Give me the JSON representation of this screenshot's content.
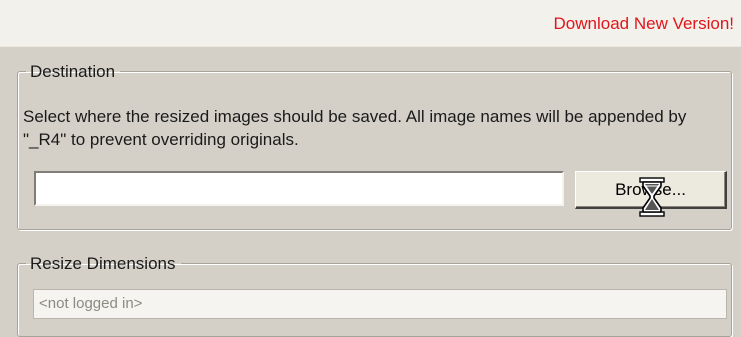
{
  "header": {
    "download_link": "Download New Version!"
  },
  "destination": {
    "legend": "Destination",
    "description": "Select where the resized images should be saved.  All image names will be appended by \"_R4\" to prevent overriding originals.",
    "path_value": "",
    "browse_label": "Browse..."
  },
  "resize": {
    "legend": "Resize Dimensions",
    "status_text": "<not logged in>"
  },
  "cursor": {
    "icon": "hourglass-icon"
  },
  "colors": {
    "window_bg": "#d4d0c8",
    "top_strip": "#f2f1ec",
    "link": "#e0161b",
    "group_border": "#a6a497"
  }
}
